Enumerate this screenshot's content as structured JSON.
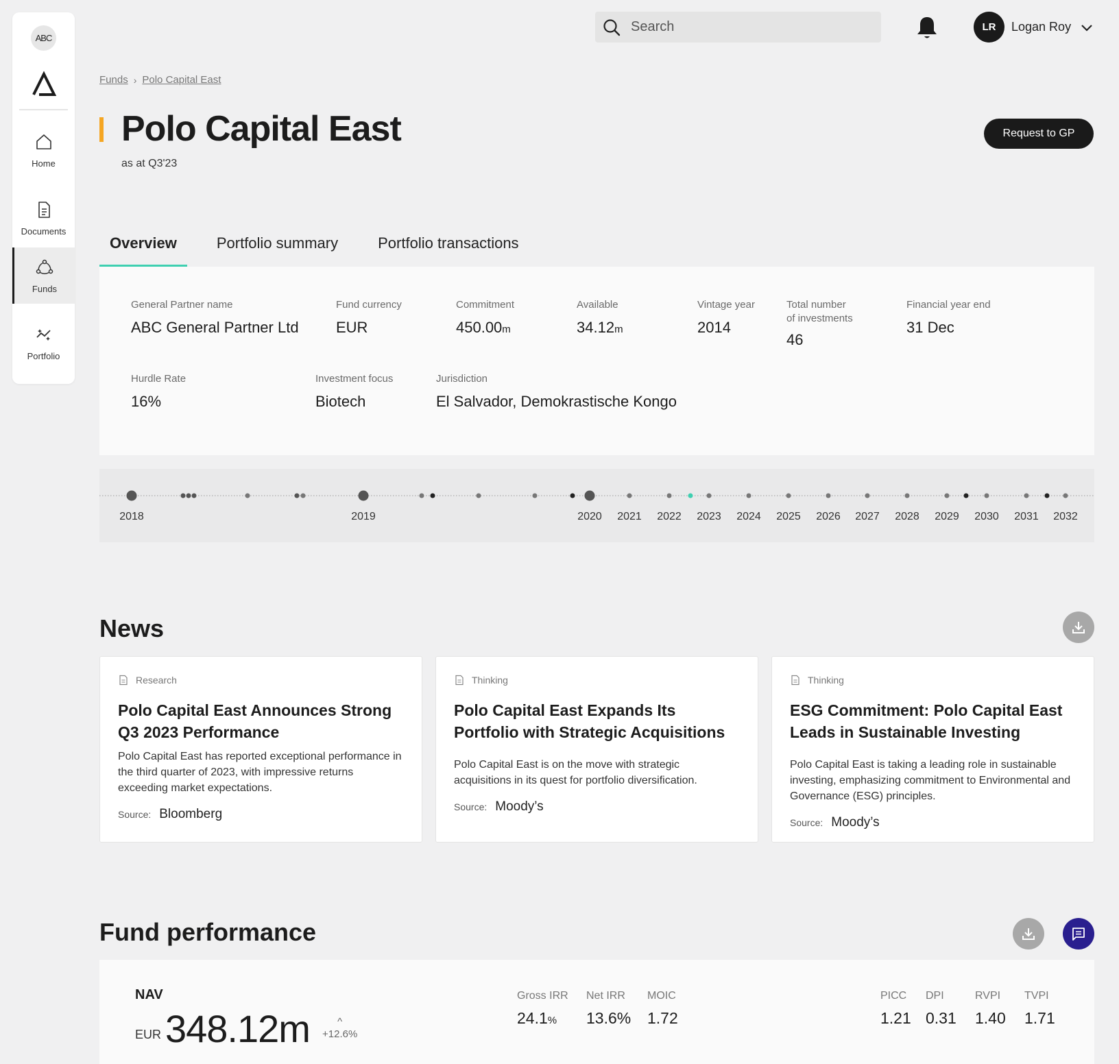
{
  "sidebar": {
    "badge": "ABC",
    "items": [
      {
        "label": "Home"
      },
      {
        "label": "Documents"
      },
      {
        "label": "Funds"
      },
      {
        "label": "Portfolio"
      }
    ]
  },
  "search": {
    "placeholder": "Search"
  },
  "user": {
    "initials": "LR",
    "name": "Logan Roy"
  },
  "breadcrumb": {
    "root": "Funds",
    "current": "Polo Capital East"
  },
  "header": {
    "title": "Polo Capital East",
    "subtitle": "as at Q3'23",
    "request_button": "Request to GP"
  },
  "tabs": [
    {
      "label": "Overview",
      "active": true
    },
    {
      "label": "Portfolio summary"
    },
    {
      "label": "Portfolio transactions"
    }
  ],
  "fund_info": {
    "gp_name": {
      "label": "General Partner name",
      "value": "ABC General Partner Ltd"
    },
    "currency": {
      "label": "Fund currency",
      "value": "EUR"
    },
    "commitment": {
      "label": "Commitment",
      "value": "450.00",
      "unit": "m"
    },
    "available": {
      "label": "Available",
      "value": "34.12",
      "unit": "m"
    },
    "vintage": {
      "label": "Vintage year",
      "value": "2014"
    },
    "investments": {
      "label_1": "Total number",
      "label_2": "of investments",
      "value": "46"
    },
    "fy_end": {
      "label": "Financial year end",
      "value": "31 Dec"
    },
    "hurdle": {
      "label": "Hurdle Rate",
      "value": "16%"
    },
    "focus": {
      "label": "Investment focus",
      "value": "Biotech"
    },
    "jurisdiction": {
      "label": "Jurisdiction",
      "value": "El Salvador, Demokrastische Kongo"
    }
  },
  "timeline": {
    "years": [
      "2018",
      "2019",
      "2020",
      "2021",
      "2022",
      "2023",
      "2024",
      "2025",
      "2026",
      "2027",
      "2028",
      "2029",
      "2030",
      "2031",
      "2032"
    ],
    "highlight_color": "#3ecfb0"
  },
  "news": {
    "title": "News",
    "items": [
      {
        "category": "Research",
        "title": "Polo Capital East Announces Strong Q3 2023 Performance",
        "body": "Polo Capital East has reported exceptional performance in the third quarter of 2023, with impressive returns exceeding market expectations.",
        "source_label": "Source:",
        "source": "Bloomberg"
      },
      {
        "category": "Thinking",
        "title": "Polo Capital East Expands Its Portfolio with Strategic Acquisitions",
        "body": "Polo Capital East is on the move with strategic acquisitions in its quest for portfolio diversification.",
        "source_label": "Source:",
        "source": "Moody’s"
      },
      {
        "category": "Thinking",
        "title": "ESG Commitment: Polo Capital East Leads in Sustainable Investing",
        "body": "Polo Capital East is taking a leading role in sustainable investing, emphasizing commitment to Environmental and Governance (ESG) principles.",
        "source_label": "Source:",
        "source": "Moody’s"
      }
    ]
  },
  "performance": {
    "title": "Fund performance",
    "nav_label": "NAV",
    "currency": "EUR",
    "nav_value": "348.12m",
    "change_symbol": "^",
    "change": "+12.6%",
    "metrics": {
      "gross_irr": {
        "label": "Gross IRR",
        "value": "24.1",
        "unit": "%"
      },
      "net_irr": {
        "label": "Net IRR",
        "value": "13.6%"
      },
      "moic": {
        "label": "MOIC",
        "value": "1.72"
      },
      "picc": {
        "label": "PICC",
        "value": "1.21"
      },
      "dpi": {
        "label": "DPI",
        "value": "0.31"
      },
      "rvpi": {
        "label": "RVPI",
        "value": "1.40"
      },
      "tvpi": {
        "label": "TVPI",
        "value": "1.71"
      }
    }
  },
  "colors": {
    "accent": "#3ecfb0",
    "title_bar": "#f5a623",
    "chat_button": "#2a1f8f"
  }
}
